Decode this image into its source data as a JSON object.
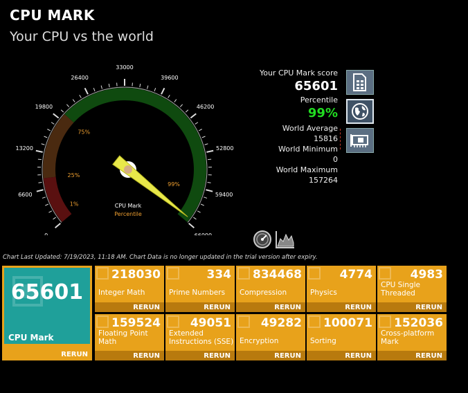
{
  "header": {
    "title": "CPU MARK",
    "subtitle": "Your CPU vs the world"
  },
  "gauge": {
    "ticks": [
      "0",
      "6600",
      "13200",
      "19800",
      "26400",
      "33000",
      "39600",
      "46200",
      "52800",
      "59400",
      "66000"
    ],
    "band_labels": [
      "1%",
      "25%",
      "75%",
      "99%"
    ],
    "center_label": "CPU Mark",
    "center_sublabel": "Percentile",
    "needle_value": 65601,
    "max": 66000,
    "colors": {
      "low": "#5a1010",
      "mid": "#4a2a10",
      "high": "#0f4a0f",
      "needle": "#e8e84a"
    }
  },
  "stats": {
    "score_label": "Your CPU Mark score",
    "score": "65601",
    "percentile_label": "Percentile",
    "percentile": "99%",
    "world_avg_label": "World Average",
    "world_avg": "15816",
    "world_min_label": "World Minimum",
    "world_min": "0",
    "world_max_label": "World Maximum",
    "world_max": "157264"
  },
  "side_buttons": [
    "document-icon",
    "globe-icon",
    "hardware-card-icon"
  ],
  "tools": [
    "speedometer-icon",
    "chart-icon"
  ],
  "chart_note": "Chart Last Updated: 7/19/2023, 11:18 AM. Chart Data is no longer updated in the trial version after expiry.",
  "main_tile": {
    "score": "65601",
    "label": "CPU Mark",
    "rerun": "RERUN"
  },
  "tests": [
    {
      "score": "218030",
      "name": "Integer Math",
      "rerun": "RERUN"
    },
    {
      "score": "334",
      "name": "Prime Numbers",
      "rerun": "RERUN"
    },
    {
      "score": "834468",
      "name": "Compression",
      "rerun": "RERUN"
    },
    {
      "score": "4774",
      "name": "Physics",
      "rerun": "RERUN"
    },
    {
      "score": "4983",
      "name": "CPU Single Threaded",
      "rerun": "RERUN"
    },
    {
      "score": "159524",
      "name": "Floating Point Math",
      "rerun": "RERUN"
    },
    {
      "score": "49051",
      "name": "Extended Instructions (SSE)",
      "rerun": "RERUN"
    },
    {
      "score": "49282",
      "name": "Encryption",
      "rerun": "RERUN"
    },
    {
      "score": "100071",
      "name": "Sorting",
      "rerun": "RERUN"
    },
    {
      "score": "152036",
      "name": "Cross-platform Mark",
      "rerun": "RERUN"
    }
  ]
}
